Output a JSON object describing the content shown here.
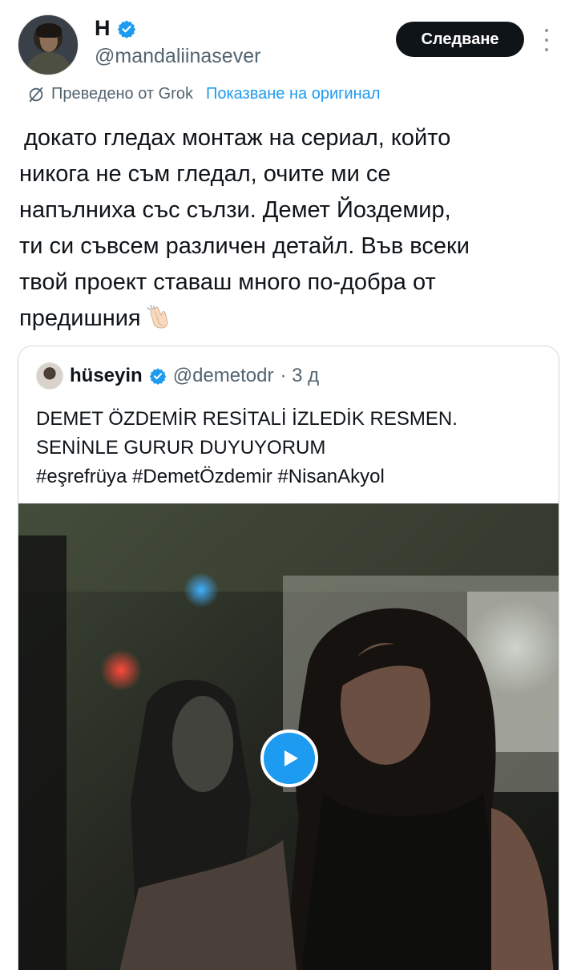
{
  "header": {
    "display_name": "H",
    "handle": "@mandaliinasever",
    "follow_label": "Следване"
  },
  "translation": {
    "translated_by": "Преведено от Grok",
    "show_original": "Показване на оригинал"
  },
  "tweet": {
    "lines": [
      "докато гледах монтаж на сериал, който",
      "никога не съм гледал, очите ми се",
      "напълниха със сълзи. Демет Йоздемир,",
      "ти си съвсем различен детайл. Във всеки",
      "твой проект ставаш много по-добра от",
      "предишния"
    ],
    "emoji": "clapping-hands"
  },
  "quote": {
    "name": "hüseyin",
    "handle": "@demetodr",
    "time": "· 3 д",
    "lines": [
      "DEMET ÖZDEMİR RESİTALİ İZLEDİK RESMEN.",
      "SENİNLE GURUR DUYUYORUM",
      "#eşrefrüya #DemetÖzdemir #NisanAkyol"
    ]
  },
  "colors": {
    "accent": "#1d9bf0",
    "text": "#0f1419",
    "muted": "#536471",
    "border": "#cfd9de"
  }
}
